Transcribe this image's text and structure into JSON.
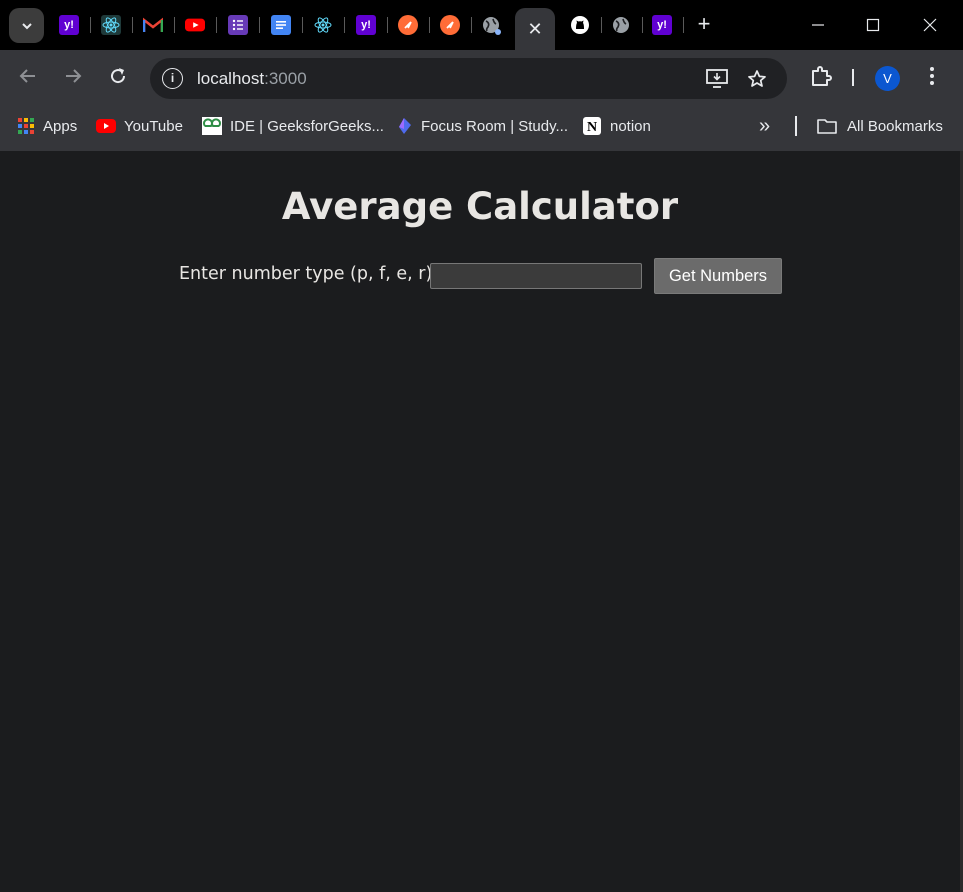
{
  "browser": {
    "tabs": [
      {
        "icon": "yahoo-icon",
        "symbol": "y!"
      },
      {
        "icon": "react-icon"
      },
      {
        "icon": "gmail-icon",
        "symbol": "M"
      },
      {
        "icon": "youtube-icon"
      },
      {
        "icon": "forms-icon"
      },
      {
        "icon": "docs-icon"
      },
      {
        "icon": "react-icon"
      },
      {
        "icon": "yahoo-icon",
        "symbol": "y!"
      },
      {
        "icon": "postman-icon"
      },
      {
        "icon": "postman-icon"
      },
      {
        "icon": "globe-icon"
      },
      {
        "icon": "close-icon",
        "active": true
      },
      {
        "icon": "github-icon"
      },
      {
        "icon": "globe-icon"
      },
      {
        "icon": "yahoo-icon",
        "symbol": "y!"
      }
    ],
    "new_tab_symbol": "+",
    "close_tab_symbol": "✕",
    "address": {
      "host": "localhost",
      "port": ":3000"
    },
    "avatar_letter": "V",
    "colors": {
      "accent": "#0b57d0",
      "page_bg": "#1b1c1e",
      "chrome_bg": "#35363a"
    }
  },
  "bookmarks": {
    "items": [
      {
        "label": "Apps",
        "icon": "apps-grid-icon"
      },
      {
        "label": "YouTube",
        "icon": "youtube-icon"
      },
      {
        "label": "IDE | GeeksforGeeks...",
        "icon": "geeksforgeeks-icon"
      },
      {
        "label": "Focus Room | Study...",
        "icon": "focus-room-icon"
      },
      {
        "label": "notion",
        "icon": "notion-icon"
      }
    ],
    "overflow_symbol": "»",
    "all_bookmarks_label": "All Bookmarks"
  },
  "page": {
    "title": "Average Calculator",
    "input_label": "Enter number type (p, f, e, r):",
    "input_value": "",
    "input_placeholder": "",
    "button_label": "Get Numbers"
  }
}
